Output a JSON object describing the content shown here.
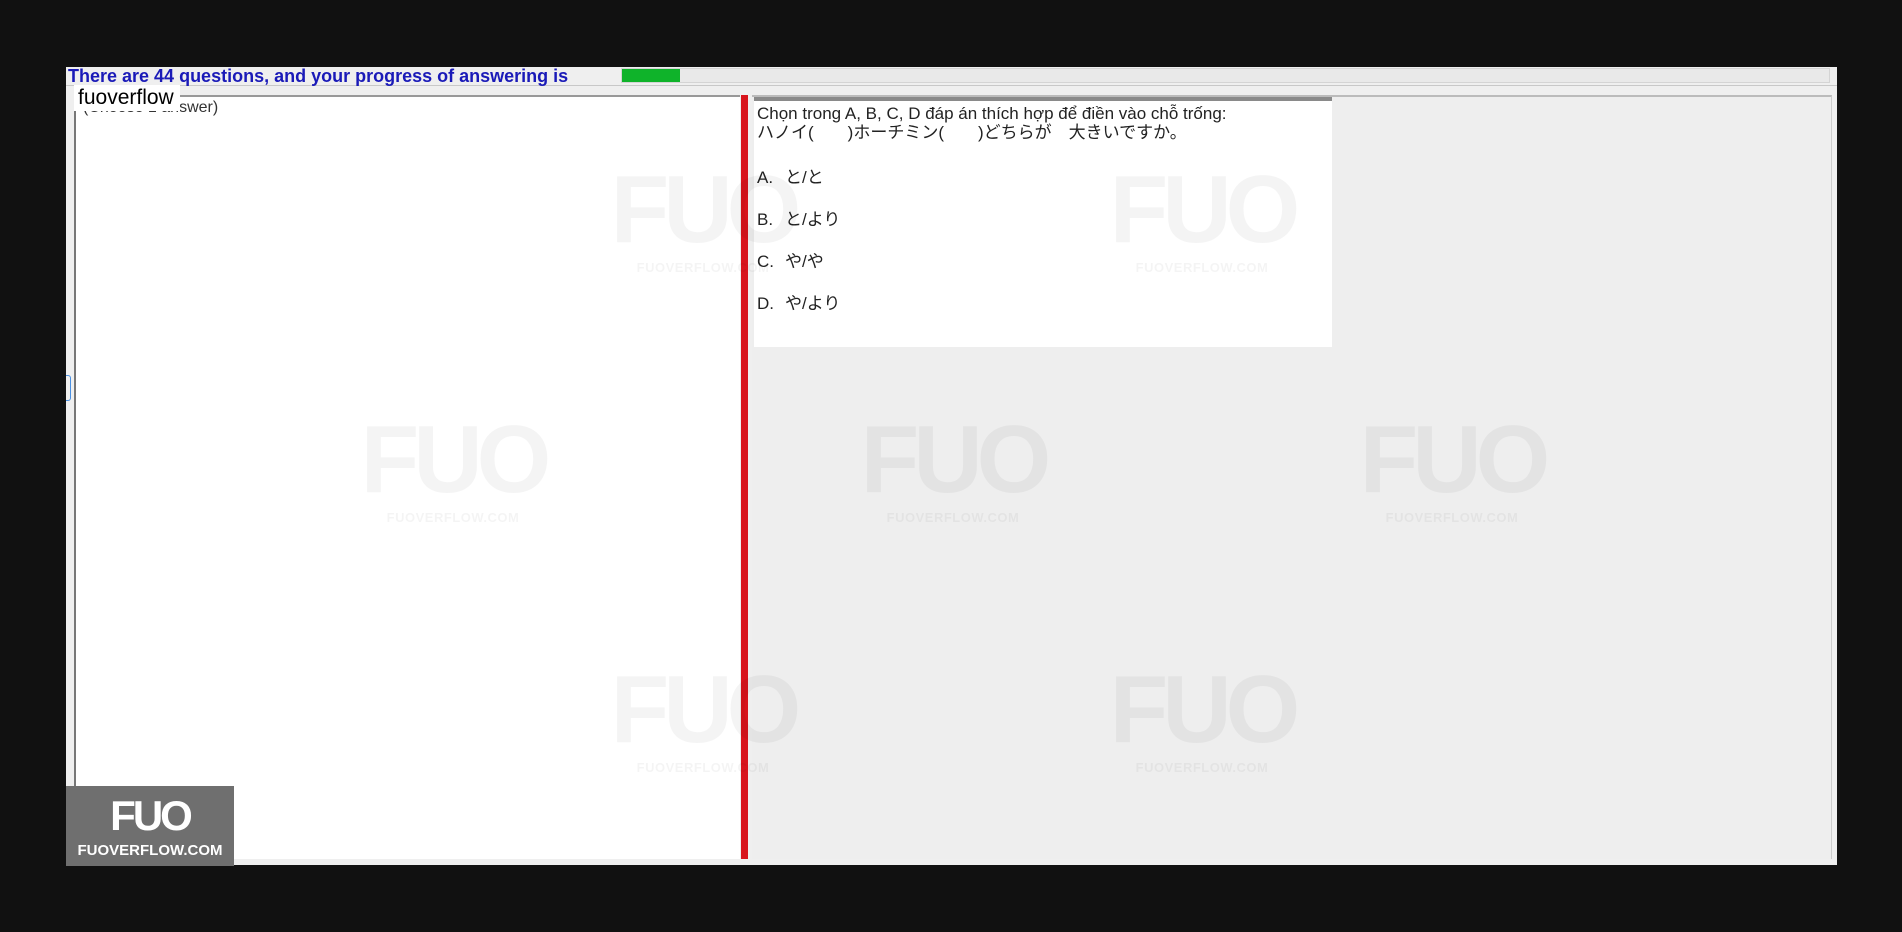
{
  "progress": {
    "text": "There are 44 questions, and your progress of answering is",
    "fraction": 0.048,
    "fill_color": "#0fb32a"
  },
  "left_panel": {
    "legend": "fuoverflow",
    "hint": "(Choose 1 answer)"
  },
  "question": {
    "prompt": "Chọn trong A, B, C, D đáp án thích hợp để điền vào chỗ trống:",
    "sentence": "ハノイ(　　)ホーチミン(　　)どちらが　大きいですか。",
    "options": [
      {
        "letter": "A.",
        "text": "と/と"
      },
      {
        "letter": "B.",
        "text": "と/より"
      },
      {
        "letter": "C.",
        "text": "や/や"
      },
      {
        "letter": "D.",
        "text": "や/より"
      }
    ]
  },
  "watermark": {
    "logo": "FUO",
    "site": "FUOVERFLOW.COM"
  },
  "corner_logo": {
    "logo": "FUO",
    "site": "FUOVERFLOW.COM"
  },
  "colors": {
    "splitter": "#d8141c",
    "progress_text": "#1a1ab8"
  }
}
